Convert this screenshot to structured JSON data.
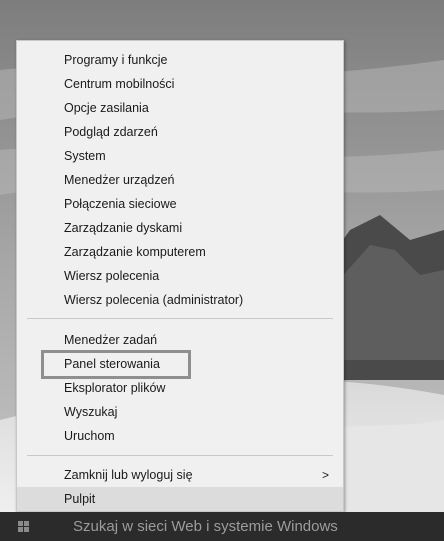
{
  "menu": {
    "items_group1": [
      {
        "label": "Programy i funkcje"
      },
      {
        "label": "Centrum mobilności"
      },
      {
        "label": "Opcje zasilania"
      },
      {
        "label": "Podgląd zdarzeń"
      },
      {
        "label": "System"
      },
      {
        "label": "Menedżer urządzeń"
      },
      {
        "label": "Połączenia sieciowe"
      },
      {
        "label": "Zarządzanie dyskami"
      },
      {
        "label": "Zarządzanie komputerem"
      },
      {
        "label": "Wiersz polecenia"
      },
      {
        "label": "Wiersz polecenia (administrator)"
      }
    ],
    "items_group2": [
      {
        "label": "Menedżer zadań"
      },
      {
        "label": "Panel sterowania"
      },
      {
        "label": "Eksplorator plików"
      },
      {
        "label": "Wyszukaj"
      },
      {
        "label": "Uruchom"
      }
    ],
    "items_group3": [
      {
        "label": "Zamknij lub wyloguj się",
        "arrow": ">"
      },
      {
        "label": "Pulpit"
      }
    ],
    "highlighted_item": "Panel sterowania",
    "hovered_item": "Pulpit"
  },
  "taskbar": {
    "start_icon": "windows-logo-icon",
    "search_placeholder": "Szukaj w sieci Web i systemie Windows"
  }
}
